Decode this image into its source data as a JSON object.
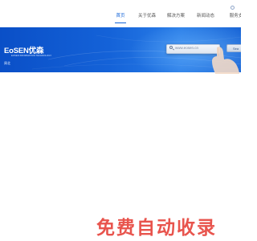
{
  "nav": {
    "items": [
      {
        "label": "首页",
        "active": true
      },
      {
        "label": "关于优森",
        "active": false
      },
      {
        "label": "解决方案",
        "active": false
      },
      {
        "label": "新闻动态",
        "active": false
      },
      {
        "label": "服务支",
        "active": false
      }
    ]
  },
  "banner": {
    "logo_text": "EoSEN优森",
    "logo_sub": "EOSEN INFORMATION TECHNOLOGY",
    "tag": "周北",
    "search_text": "www.eosen.cn",
    "search_button": "Sea"
  },
  "watermark": "免费自动收录",
  "colors": {
    "accent": "#1565d8",
    "banner_blue": "#1462d8",
    "watermark_red": "#e7463e"
  }
}
